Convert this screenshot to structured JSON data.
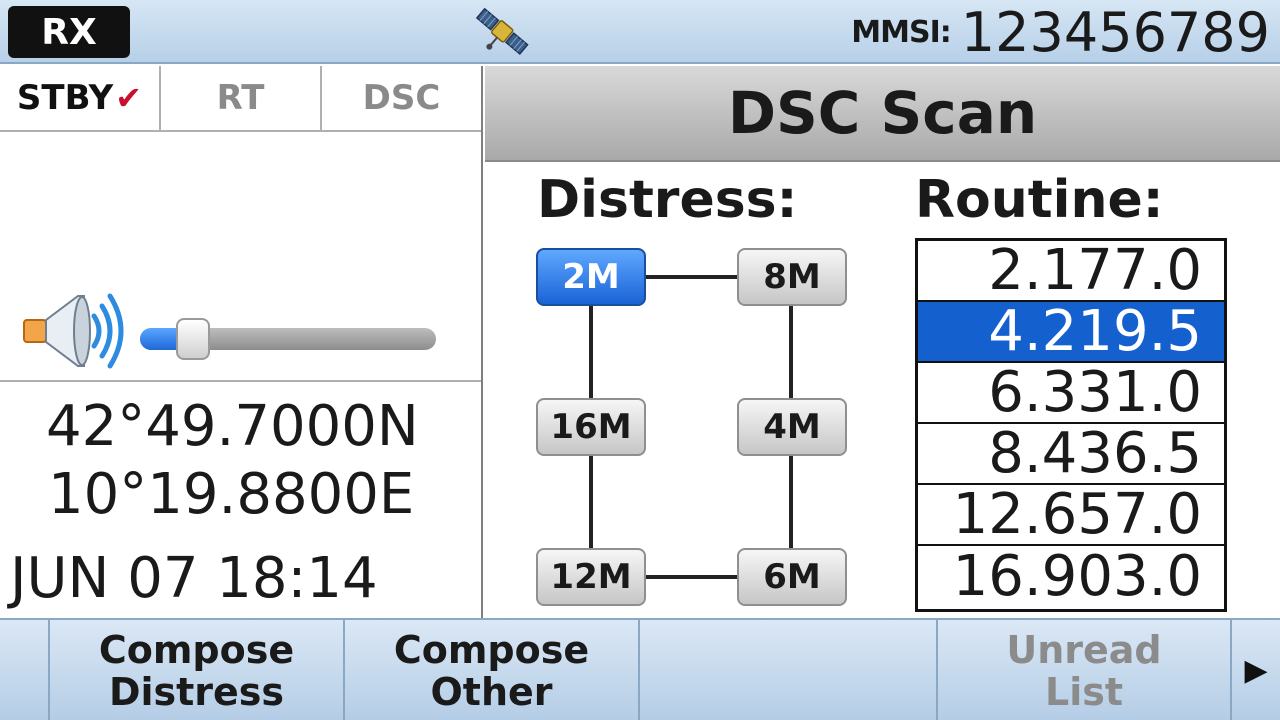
{
  "status_bar": {
    "rx_label": "RX",
    "mmsi_label": "MMSI:",
    "mmsi_value": "123456789"
  },
  "mode_tabs": [
    {
      "label": "STBY",
      "active": true,
      "checked": true
    },
    {
      "label": "RT",
      "active": false
    },
    {
      "label": "DSC",
      "active": false
    }
  ],
  "volume": {
    "level": 0.18
  },
  "position": {
    "latitude": "42°49.7000N",
    "longitude": "10°19.8800E"
  },
  "datetime": "JUN 07 18:14",
  "panel": {
    "title": "DSC Scan",
    "distress_label": "Distress:",
    "routine_label": "Routine:",
    "distress_frequencies": [
      "2M",
      "8M",
      "16M",
      "4M",
      "12M",
      "6M"
    ],
    "distress_selected": "2M",
    "routine_frequencies": [
      "2.177.0",
      "4.219.5",
      "6.331.0",
      "8.436.5",
      "12.657.0",
      "16.903.0"
    ],
    "routine_selected": "4.219.5"
  },
  "softkeys": {
    "compose_distress_line1": "Compose",
    "compose_distress_line2": "Distress",
    "compose_other_line1": "Compose",
    "compose_other_line2": "Other",
    "unread_list_line1": "Unread",
    "unread_list_line2": "List",
    "next_arrow": "▶"
  },
  "colors": {
    "accent_blue": "#1560cf",
    "check_red": "#c8102e",
    "bar_blue": "#c6dbef"
  },
  "icons": {
    "satellite": "satellite-icon",
    "speaker": "speaker-volume-icon",
    "check": "check-icon",
    "arrow": "chevron-right-icon"
  }
}
